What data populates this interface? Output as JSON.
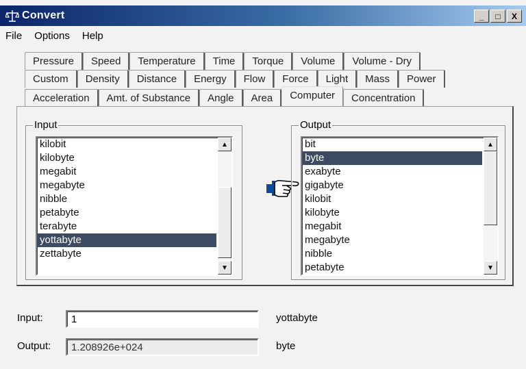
{
  "window": {
    "title": "Convert",
    "minimize": "_",
    "maximize": "□",
    "close": "X"
  },
  "menu": [
    "File",
    "Options",
    "Help"
  ],
  "tabs": {
    "row1": [
      "Pressure",
      "Speed",
      "Temperature",
      "Time",
      "Torque",
      "Volume",
      "Volume - Dry"
    ],
    "row2": [
      "Custom",
      "Density",
      "Distance",
      "Energy",
      "Flow",
      "Force",
      "Light",
      "Mass",
      "Power"
    ],
    "row3": [
      "Acceleration",
      "Amt. of Substance",
      "Angle",
      "Area",
      "Computer",
      "Concentration"
    ],
    "active": "Computer"
  },
  "input_group": {
    "label": "Input",
    "items": [
      "kilobit",
      "kilobyte",
      "megabit",
      "megabyte",
      "nibble",
      "petabyte",
      "terabyte",
      "yottabyte",
      "zettabyte"
    ],
    "selected": "yottabyte"
  },
  "output_group": {
    "label": "Output",
    "items": [
      "bit",
      "byte",
      "exabyte",
      "gigabyte",
      "kilobit",
      "kilobyte",
      "megabit",
      "megabyte",
      "nibble",
      "petabyte"
    ],
    "selected": "byte"
  },
  "fields": {
    "input_label": "Input:",
    "input_value": "1",
    "input_unit": "yottabyte",
    "output_label": "Output:",
    "output_value": "1.208926e+024",
    "output_unit": "byte"
  },
  "icons": {
    "app": "scales-icon",
    "convert": "pointing-hand-icon",
    "scroll_up": "▲",
    "scroll_down": "▼"
  },
  "colors": {
    "selection": "#3c4a62",
    "titlebar_start": "#0b246a",
    "titlebar_end": "#a6caf0"
  }
}
